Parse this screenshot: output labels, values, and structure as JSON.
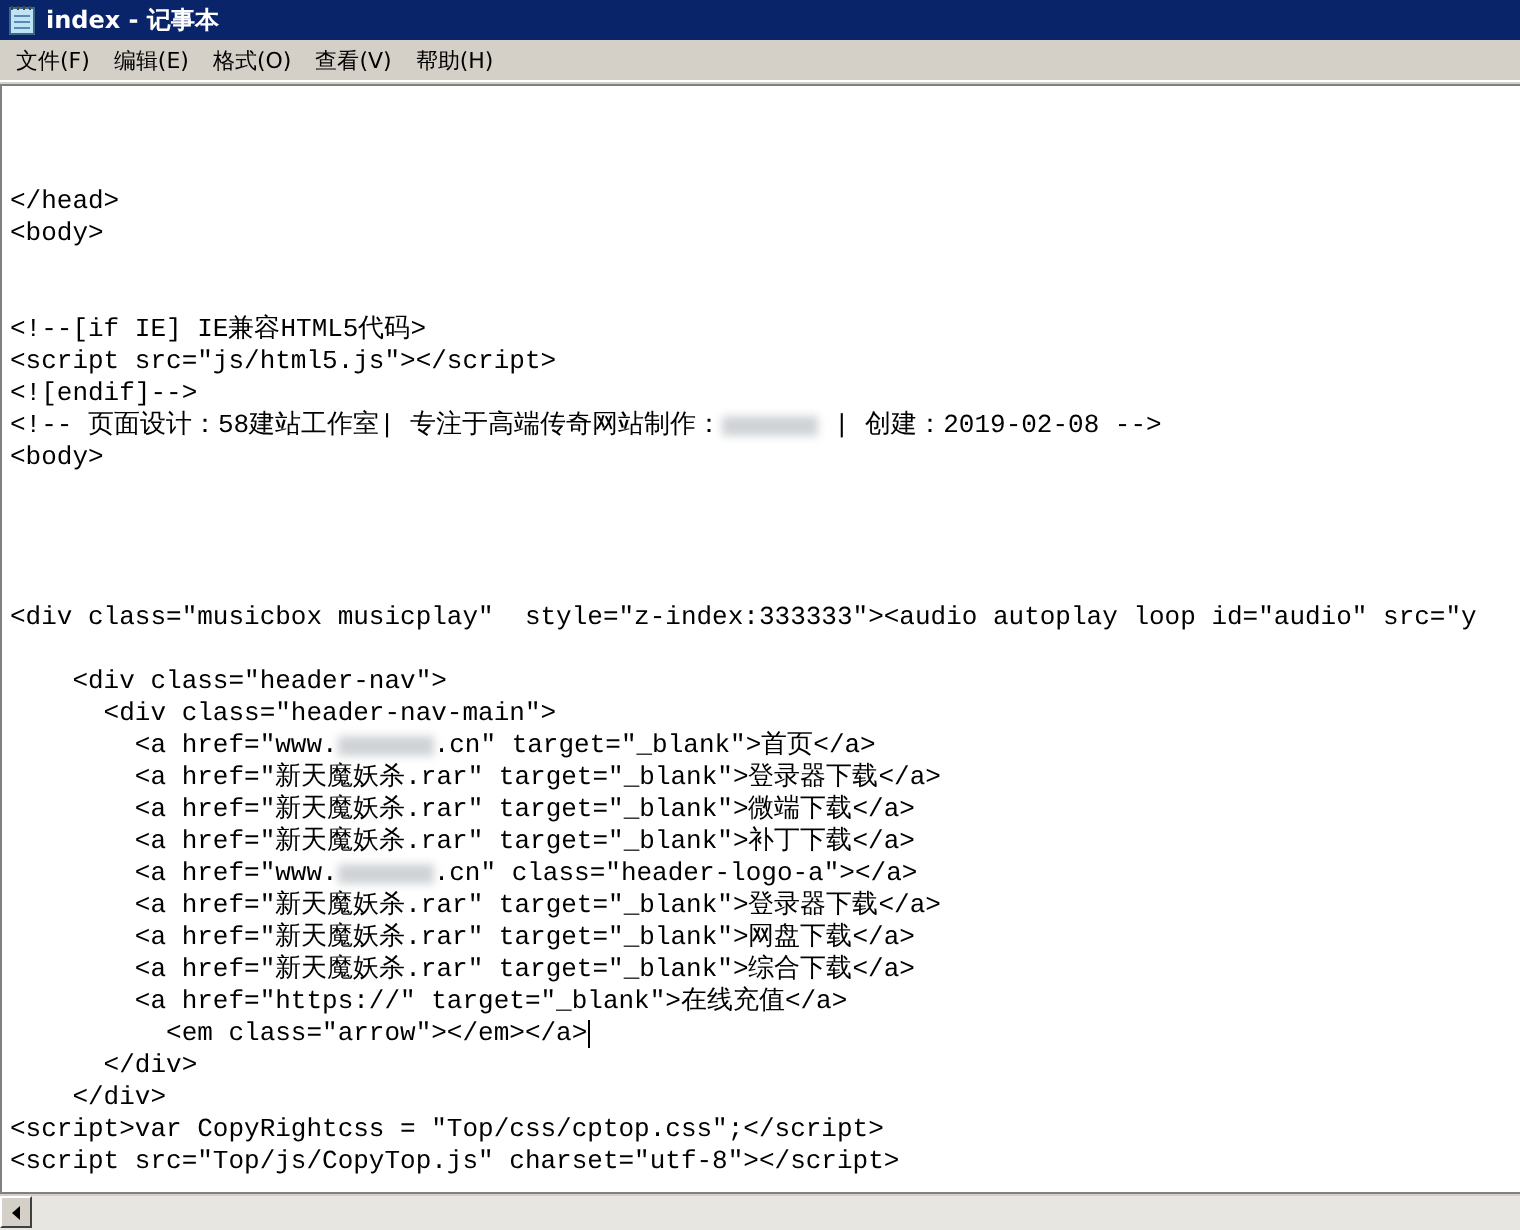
{
  "window": {
    "title": "index - 记事本"
  },
  "menu": [
    "文件(F)",
    "编辑(E)",
    "格式(O)",
    "查看(V)",
    "帮助(H)"
  ],
  "editor": {
    "lines": [
      {
        "kind": "blank"
      },
      {
        "kind": "blank"
      },
      {
        "kind": "blank"
      },
      {
        "kind": "text",
        "text": "</head>"
      },
      {
        "kind": "text",
        "text": "<body>"
      },
      {
        "kind": "blank"
      },
      {
        "kind": "blank"
      },
      {
        "kind": "text",
        "text": "<!--[if IE] IE兼容HTML5代码>"
      },
      {
        "kind": "text",
        "text": "<script src=\"js/html5.js\"></script>"
      },
      {
        "kind": "text",
        "text": "<![endif]-->"
      },
      {
        "kind": "redacted",
        "before": "<!-- 页面设计：58建站工作室| 专注于高端传奇网站制作：",
        "after": " | 创建：2019-02-08 -->"
      },
      {
        "kind": "text",
        "text": "<body>"
      },
      {
        "kind": "blank"
      },
      {
        "kind": "blank"
      },
      {
        "kind": "blank"
      },
      {
        "kind": "blank"
      },
      {
        "kind": "text",
        "text": "<div class=\"musicbox musicplay\"  style=\"z-index:333333\"><audio autoplay loop id=\"audio\" src=\"y"
      },
      {
        "kind": "blank"
      },
      {
        "kind": "text",
        "text": "    <div class=\"header-nav\">"
      },
      {
        "kind": "text",
        "text": "      <div class=\"header-nav-main\">"
      },
      {
        "kind": "redacted",
        "before": "        <a href=\"www.",
        "after": ".cn\" target=\"_blank\">首页</a>"
      },
      {
        "kind": "text",
        "text": "        <a href=\"新天魔妖杀.rar\" target=\"_blank\">登录器下载</a>"
      },
      {
        "kind": "text",
        "text": "        <a href=\"新天魔妖杀.rar\" target=\"_blank\">微端下载</a>"
      },
      {
        "kind": "text",
        "text": "        <a href=\"新天魔妖杀.rar\" target=\"_blank\">补丁下载</a>"
      },
      {
        "kind": "redacted",
        "before": "        <a href=\"www.",
        "after": ".cn\" class=\"header-logo-a\"></a>"
      },
      {
        "kind": "text",
        "text": "        <a href=\"新天魔妖杀.rar\" target=\"_blank\">登录器下载</a>"
      },
      {
        "kind": "text",
        "text": "        <a href=\"新天魔妖杀.rar\" target=\"_blank\">网盘下载</a>"
      },
      {
        "kind": "text",
        "text": "        <a href=\"新天魔妖杀.rar\" target=\"_blank\">综合下载</a>"
      },
      {
        "kind": "text",
        "text": "        <a href=\"https://\" target=\"_blank\">在线充值</a>"
      },
      {
        "kind": "caret",
        "text": "          <em class=\"arrow\"></em></a>"
      },
      {
        "kind": "text",
        "text": "      </div>"
      },
      {
        "kind": "text",
        "text": "    </div>"
      },
      {
        "kind": "text",
        "text": "<script>var CopyRightcss = \"Top/css/cptop.css\";</script>"
      },
      {
        "kind": "text",
        "text": "<script src=\"Top/js/CopyTop.js\" charset=\"utf-8\"></script>"
      }
    ]
  }
}
